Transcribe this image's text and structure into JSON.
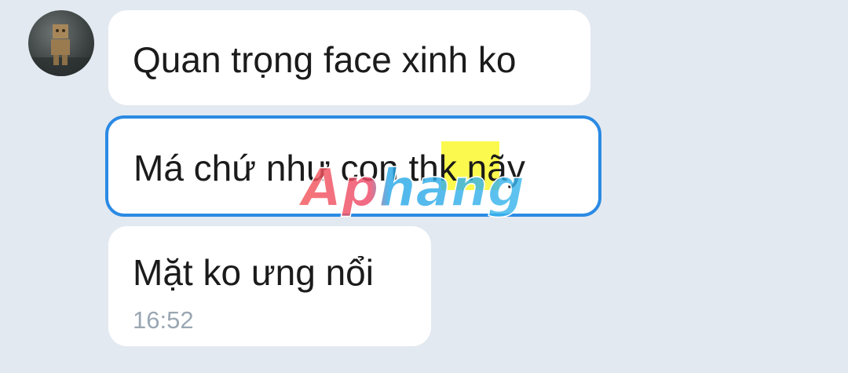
{
  "messages": [
    {
      "text": "Quan trọng face xinh ko"
    },
    {
      "text": "Má chứ như con thk nãy"
    },
    {
      "text": "Mặt ko ưng nổi",
      "time": "16:52"
    }
  ],
  "watermark": {
    "text": "Aphang"
  },
  "colors": {
    "background": "#e3e9f0",
    "bubble": "#ffffff",
    "selected_border": "#2b8ae4",
    "highlight": "#fbf94e",
    "timestamp": "#9aa7b3"
  }
}
